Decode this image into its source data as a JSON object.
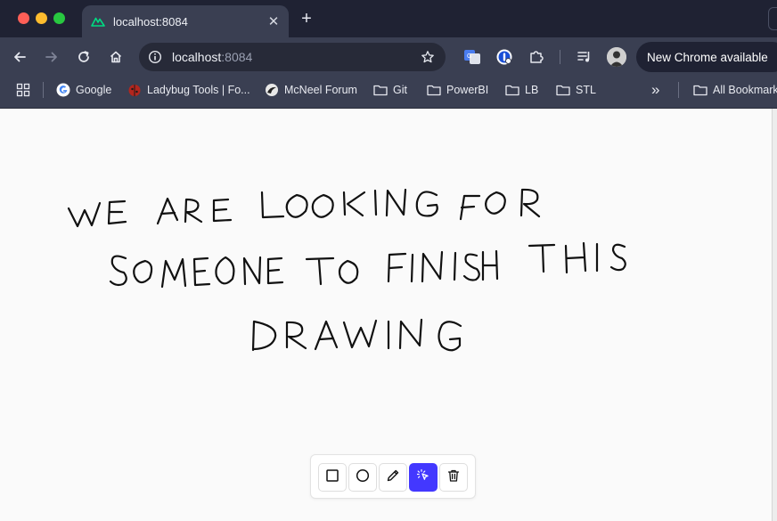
{
  "tab": {
    "title": "localhost:8084",
    "close_glyph": "✕"
  },
  "new_tab_glyph": "+",
  "omnibox": {
    "host": "localhost",
    "port": ":8084"
  },
  "update_pill": {
    "label": "New Chrome available"
  },
  "bookmarks": [
    {
      "label": "Google",
      "icon": "google-icon"
    },
    {
      "label": "Ladybug Tools | Fo...",
      "icon": "ladybug-icon"
    },
    {
      "label": "McNeel Forum",
      "icon": "mcneel-icon"
    },
    {
      "label": "Git",
      "icon": "folder-icon"
    },
    {
      "label": "PowerBI",
      "icon": "folder-icon"
    },
    {
      "label": "LB",
      "icon": "folder-icon"
    },
    {
      "label": "STL",
      "icon": "folder-icon"
    }
  ],
  "bookmarks_overflow_glyph": "»",
  "all_bookmarks": {
    "label": "All Bookmarks"
  },
  "drawing": {
    "text_lines": [
      "WE ARE LOOKING FOR",
      "SOMEONE TO FINISH THIS",
      "DRAWING"
    ],
    "stroke_color": "#111111"
  },
  "tools": [
    {
      "name": "rectangle-tool",
      "icon": "square-icon",
      "active": false
    },
    {
      "name": "ellipse-tool",
      "icon": "circle-icon",
      "active": false
    },
    {
      "name": "pencil-tool",
      "icon": "pencil-icon",
      "active": false
    },
    {
      "name": "select-tool",
      "icon": "cursor-click-icon",
      "active": true
    },
    {
      "name": "delete-tool",
      "icon": "trash-icon",
      "active": false
    }
  ],
  "colors": {
    "accent": "#4338ff",
    "chrome_dark": "#1f2233",
    "chrome": "#3a3f52"
  }
}
